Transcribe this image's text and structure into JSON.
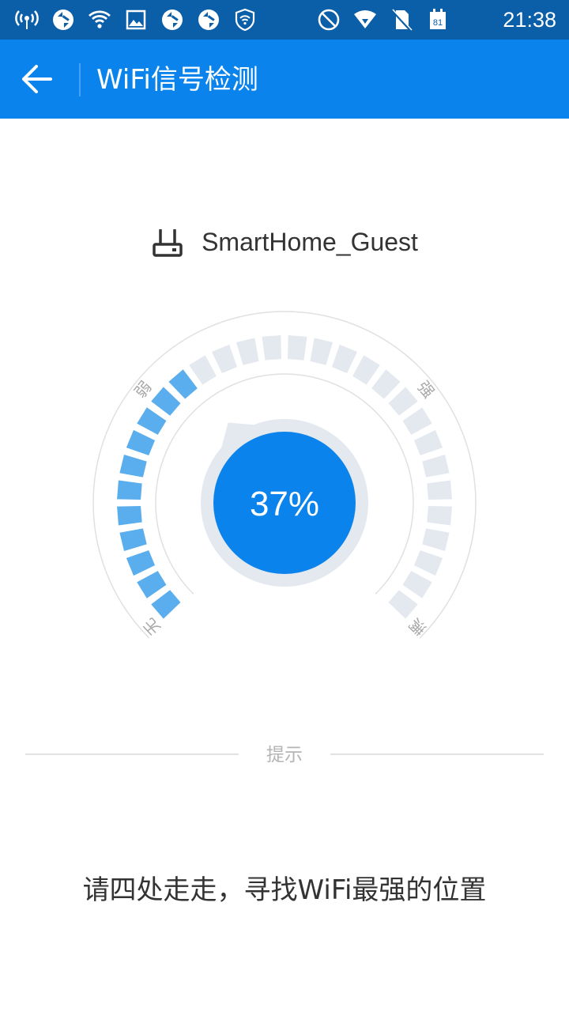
{
  "status_bar": {
    "time": "21:38",
    "calendar_day": "81",
    "left_icons": [
      "wifi-hotspot-icon",
      "sync-icon",
      "wifi-icon",
      "image-icon",
      "sync-icon",
      "sync-icon",
      "shield-wifi-icon"
    ],
    "right_icons": [
      "do-not-disturb-icon",
      "wifi-signal-icon",
      "no-sim-icon",
      "calendar-icon"
    ]
  },
  "app_bar": {
    "title": "WiFi信号检测",
    "back_icon": "arrow-left-icon",
    "color": "#0a84ec"
  },
  "network": {
    "ssid": "SmartHome_Guest",
    "icon": "router-icon"
  },
  "gauge": {
    "percent_text": "37%",
    "signal_strength": 0.37,
    "segments_total": 30,
    "segments_active": 11,
    "labels": {
      "none": "无",
      "weak": "弱",
      "strong": "强",
      "full": "满"
    },
    "colors": {
      "active": "#5aaeee",
      "inactive": "#e4e8ef",
      "center": "#0a84ec",
      "ring": "#e4e8ef"
    }
  },
  "tip": {
    "label": "提示",
    "text": "请四处走走，寻找WiFi最强的位置"
  }
}
